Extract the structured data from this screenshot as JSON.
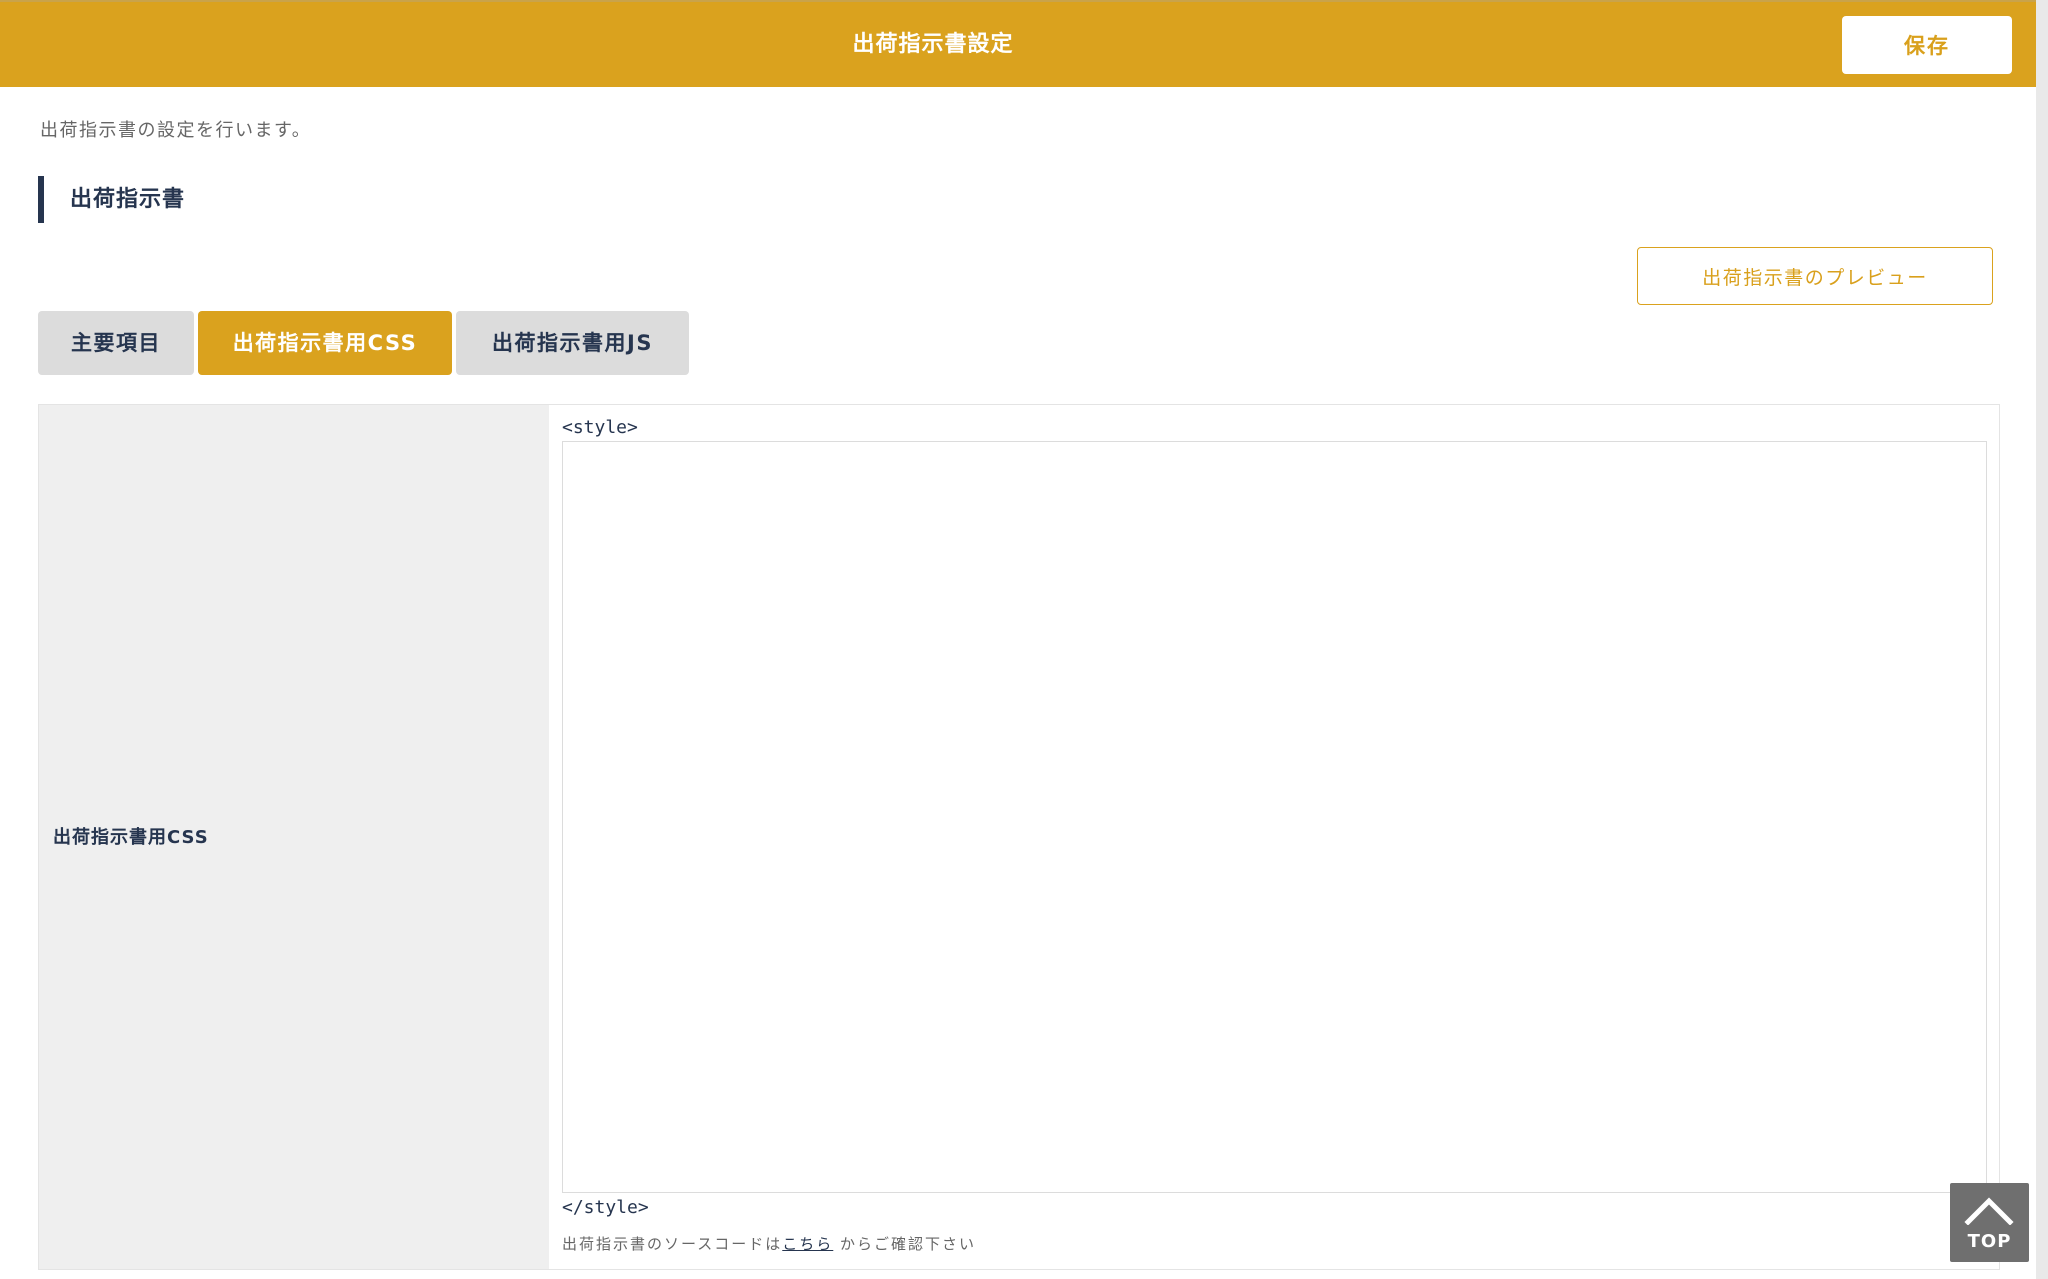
{
  "header": {
    "title": "出荷指示書設定",
    "save_label": "保存"
  },
  "description": "出荷指示書の設定を行います。",
  "section": {
    "title": "出荷指示書"
  },
  "preview_button_label": "出荷指示書のプレビュー",
  "tabs": [
    {
      "label": "主要項目",
      "active": false
    },
    {
      "label": "出荷指示書用CSS",
      "active": true
    },
    {
      "label": "出荷指示書用JS",
      "active": false
    }
  ],
  "form": {
    "row_label": "出荷指示書用CSS",
    "code_open": "<style>",
    "textarea_value": "",
    "code_close": "</style>",
    "note_prefix": "出荷指示書のソースコードは",
    "note_link": "こちら",
    "note_suffix": " からご確認下さい"
  },
  "top_button": {
    "label": "TOP",
    "icon": "chevron-up-icon"
  },
  "colors": {
    "accent": "#daa21e",
    "navy": "#26354f",
    "label_bg": "#efefef",
    "tab_inactive": "#dcdcdc"
  }
}
